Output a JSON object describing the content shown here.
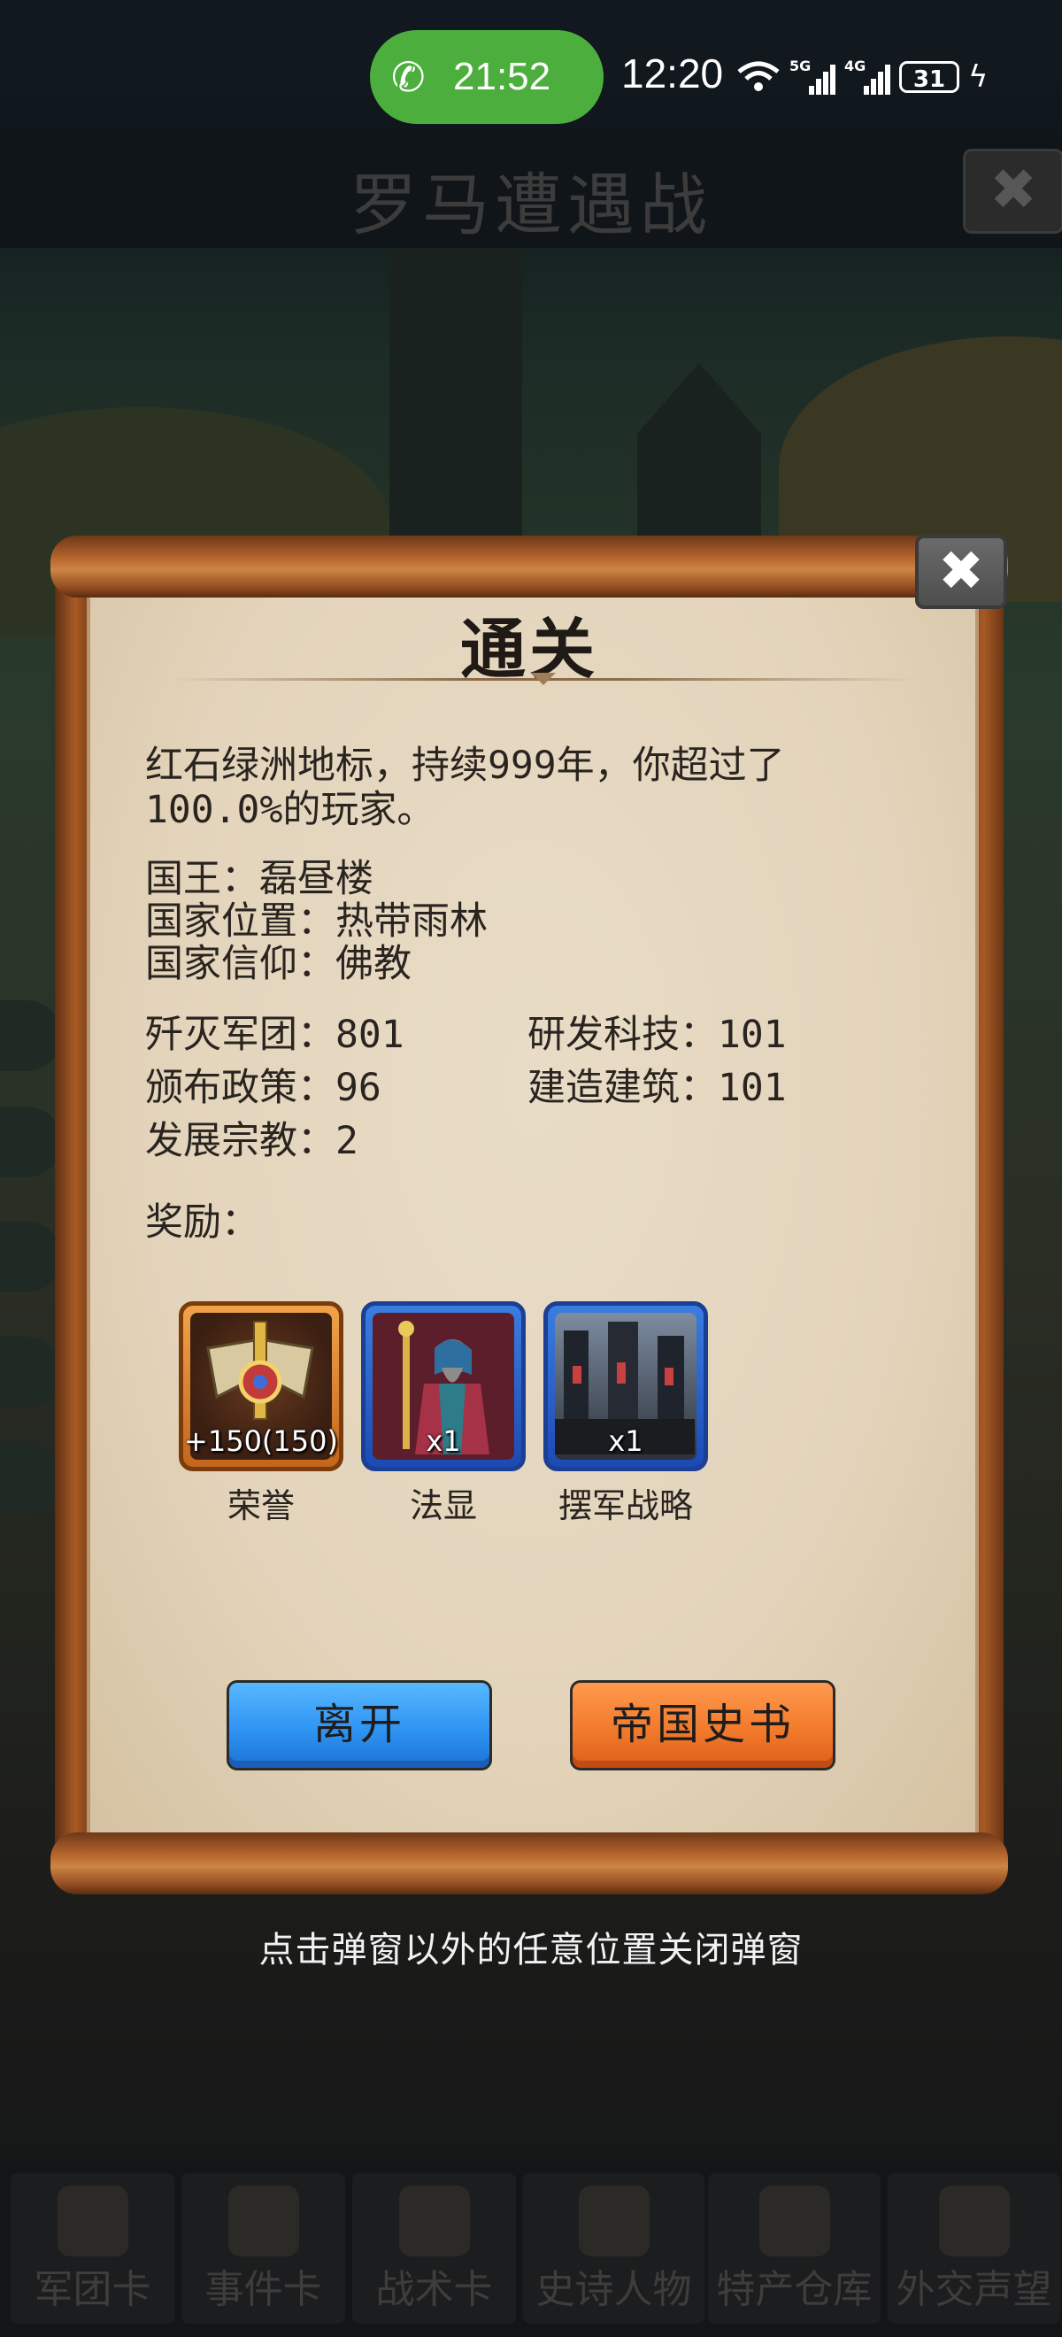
{
  "status_bar": {
    "call_time": "21:52",
    "clock": "12:20",
    "net1": "5G",
    "net2": "4G",
    "battery": "31"
  },
  "background": {
    "page_title": "罗马遭遇战",
    "bottom_tabs": [
      "军团卡",
      "事件卡",
      "战术卡",
      "史诗人物",
      "特产仓库",
      "外交声望"
    ]
  },
  "dialog": {
    "title": "通关",
    "summary_line1": "红石绿洲地标，持续999年，你超过了",
    "summary_line2": "100.0%的玩家。",
    "king": "国王：磊昼楼",
    "location": "国家位置：热带雨林",
    "religion": "国家信仰：佛教",
    "stats": {
      "destroyed_legions": "歼灭军团：801",
      "researched_tech": "研发科技：101",
      "issued_policies": "颁布政策：96",
      "built_buildings": "建造建筑：101",
      "developed_religion": "发展宗教：2"
    },
    "rewards_label": "奖励：",
    "rewards": [
      {
        "name": "荣誉",
        "qty": "+150(150)"
      },
      {
        "name": "法显",
        "qty": "x1"
      },
      {
        "name": "摆军战略",
        "qty": "x1"
      }
    ],
    "leave_button": "离开",
    "history_button": "帝国史书"
  },
  "hint": "点击弹窗以外的任意位置关闭弹窗",
  "colors": {
    "leave_button": "#2f94f3",
    "history_button": "#f37a2b",
    "call_pill": "#4caf3d"
  }
}
